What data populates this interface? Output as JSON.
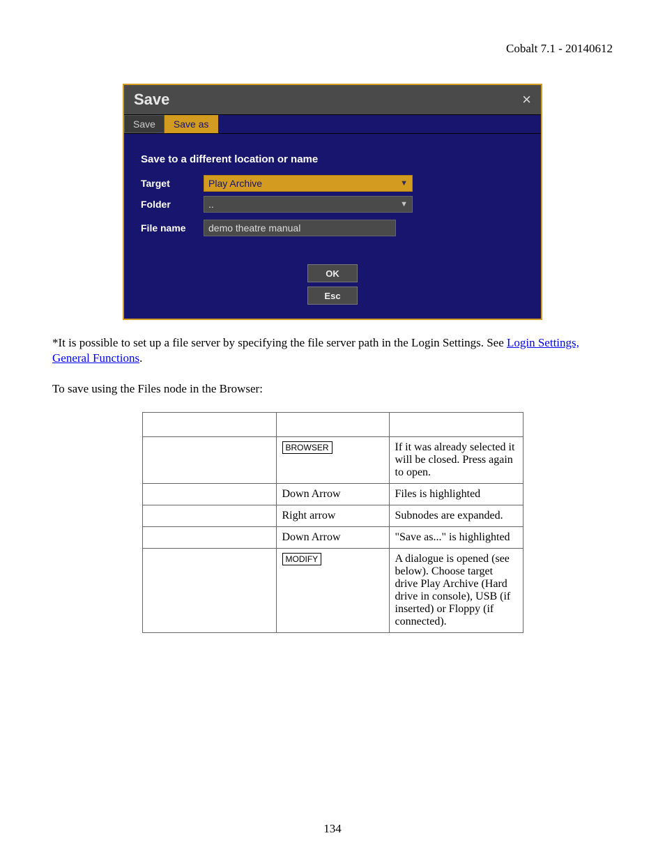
{
  "header": {
    "product": "Cobalt 7.1 - 20140612"
  },
  "dialog": {
    "title": "Save",
    "close_glyph": "×",
    "tabs": {
      "save": "Save",
      "save_as": "Save as"
    },
    "heading": "Save to a different location or name",
    "labels": {
      "target": "Target",
      "folder": "Folder",
      "filename": "File name"
    },
    "values": {
      "target": "Play Archive",
      "folder": "..",
      "filename": "demo theatre manual"
    },
    "buttons": {
      "ok": "OK",
      "esc": "Esc"
    }
  },
  "paragraphs": {
    "note_prefix": "*It is possible to set up a file server by specifying the file server path in the Login Settings. See ",
    "note_link": "Login Settings, General Functions",
    "note_suffix": ".",
    "intro": "To save using the Files node in the Browser:"
  },
  "table": {
    "rows": [
      {
        "c1": "",
        "c2_type": "key",
        "c2": "BROWSER",
        "c3": "If it was already selected it will be closed. Press again to open."
      },
      {
        "c1": "",
        "c2_type": "text",
        "c2": "Down Arrow",
        "c3": "Files is highlighted"
      },
      {
        "c1": "",
        "c2_type": "text",
        "c2": "Right arrow",
        "c3": "Subnodes are expanded."
      },
      {
        "c1": "",
        "c2_type": "text",
        "c2": "Down Arrow",
        "c3": "\"Save as...\" is highlighted"
      },
      {
        "c1": "",
        "c2_type": "key",
        "c2": "MODIFY",
        "c3": "A dialogue is opened (see below). Choose target drive Play Archive (Hard drive in console), USB (if inserted) or Floppy (if connected)."
      }
    ]
  },
  "page_number": "134"
}
